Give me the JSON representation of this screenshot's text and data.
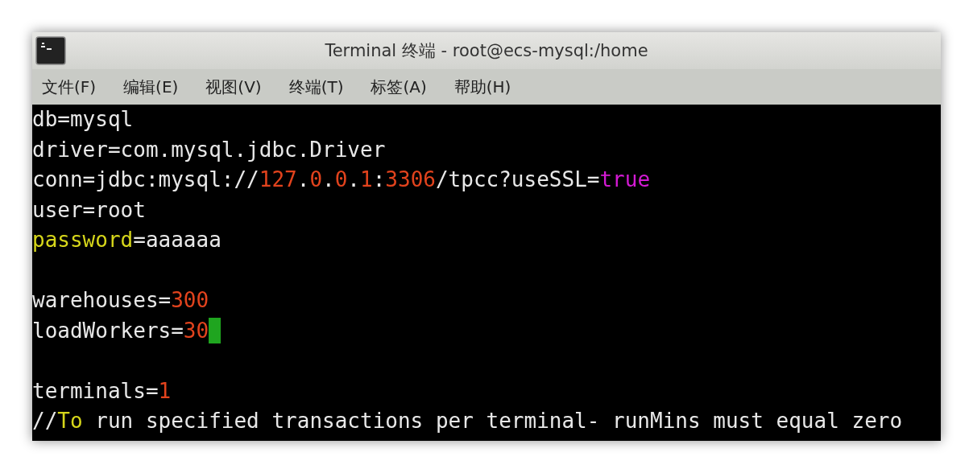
{
  "window": {
    "title": "Terminal 终端 - root@ecs-mysql:/home"
  },
  "menu": [
    {
      "label": "文件(F)"
    },
    {
      "label": "编辑(E)"
    },
    {
      "label": "视图(V)"
    },
    {
      "label": "终端(T)"
    },
    {
      "label": "标签(A)"
    },
    {
      "label": "帮助(H)"
    }
  ],
  "terminal": {
    "lines": [
      {
        "kind": "text",
        "cursor": false,
        "segments": [
          {
            "text": "db=mysql",
            "kind": "plain"
          }
        ]
      },
      {
        "kind": "text",
        "cursor": false,
        "segments": [
          {
            "text": "driver=com.mysql.jdbc.Driver",
            "kind": "plain"
          }
        ]
      },
      {
        "kind": "text",
        "cursor": false,
        "segments": [
          {
            "text": "conn=jdbc:mysql://",
            "kind": "plain"
          },
          {
            "text": "127",
            "kind": "number"
          },
          {
            "text": ".",
            "kind": "plain"
          },
          {
            "text": "0",
            "kind": "number"
          },
          {
            "text": ".",
            "kind": "plain"
          },
          {
            "text": "0",
            "kind": "number"
          },
          {
            "text": ".",
            "kind": "plain"
          },
          {
            "text": "1",
            "kind": "number"
          },
          {
            "text": ":",
            "kind": "plain"
          },
          {
            "text": "3306",
            "kind": "number"
          },
          {
            "text": "/tpcc?useSSL=",
            "kind": "plain"
          },
          {
            "text": "true",
            "kind": "boolean"
          }
        ]
      },
      {
        "kind": "text",
        "cursor": false,
        "segments": [
          {
            "text": "user=root",
            "kind": "plain"
          }
        ]
      },
      {
        "kind": "text",
        "cursor": false,
        "segments": [
          {
            "text": "password",
            "kind": "keyword"
          },
          {
            "text": "=aaaaaa",
            "kind": "plain"
          }
        ]
      },
      {
        "kind": "blank"
      },
      {
        "kind": "text",
        "cursor": false,
        "segments": [
          {
            "text": "warehouses=",
            "kind": "plain"
          },
          {
            "text": "300",
            "kind": "number"
          }
        ]
      },
      {
        "kind": "text",
        "cursor": true,
        "segments": [
          {
            "text": "loadWorkers=",
            "kind": "plain"
          },
          {
            "text": "30",
            "kind": "number"
          }
        ]
      },
      {
        "kind": "blank"
      },
      {
        "kind": "text",
        "cursor": false,
        "segments": [
          {
            "text": "terminals=",
            "kind": "plain"
          },
          {
            "text": "1",
            "kind": "number"
          }
        ]
      },
      {
        "kind": "text",
        "cursor": false,
        "segments": [
          {
            "text": "//",
            "kind": "plain"
          },
          {
            "text": "To",
            "kind": "keyword"
          },
          {
            "text": " run specified transactions per terminal- runMins must equal zero",
            "kind": "plain"
          }
        ]
      }
    ]
  }
}
